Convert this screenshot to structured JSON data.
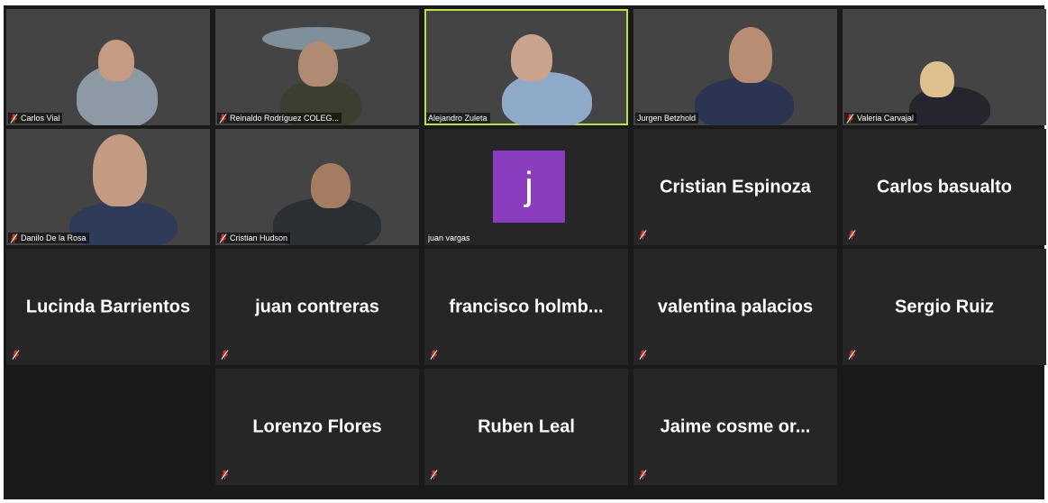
{
  "colors": {
    "stage_bg": "#1a1a1a",
    "tile_bg": "#262626",
    "active_border": "#b9e24a",
    "muted_icon": "#e0352b",
    "avatar_bg": "#8a3dbf"
  },
  "participants": [
    {
      "name": "Carlos Vial",
      "muted": true,
      "video": true
    },
    {
      "name": "Reinaldo Rodríguez  COLEG...",
      "muted": true,
      "video": true
    },
    {
      "name": "Alejandro Zuleta",
      "muted": false,
      "video": true,
      "active_speaker": true
    },
    {
      "name": "Jurgen Betzhold",
      "muted": false,
      "video": true
    },
    {
      "name": "Valeria Carvajal",
      "muted": true,
      "video": true
    },
    {
      "name": "Danilo De la Rosa",
      "muted": true,
      "video": true
    },
    {
      "name": "Cristian Hudson",
      "muted": true,
      "video": true
    },
    {
      "name": "juan vargas",
      "muted": false,
      "video": false,
      "avatar_letter": "j"
    },
    {
      "name": "Cristian Espinoza",
      "muted": true,
      "video": false
    },
    {
      "name": "Carlos basualto",
      "muted": true,
      "video": false
    },
    {
      "name": "Lucinda Barrientos",
      "muted": true,
      "video": false
    },
    {
      "name": "juan contreras",
      "muted": true,
      "video": false
    },
    {
      "name": "francisco  holmb...",
      "muted": true,
      "video": false
    },
    {
      "name": "valentina palacios",
      "muted": true,
      "video": false
    },
    {
      "name": "Sergio Ruiz",
      "muted": true,
      "video": false
    },
    {
      "name": "Lorenzo Flores",
      "muted": true,
      "video": false
    },
    {
      "name": "Ruben Leal",
      "muted": true,
      "video": false
    },
    {
      "name": "Jaime  cosme  or...",
      "muted": true,
      "video": false
    }
  ]
}
